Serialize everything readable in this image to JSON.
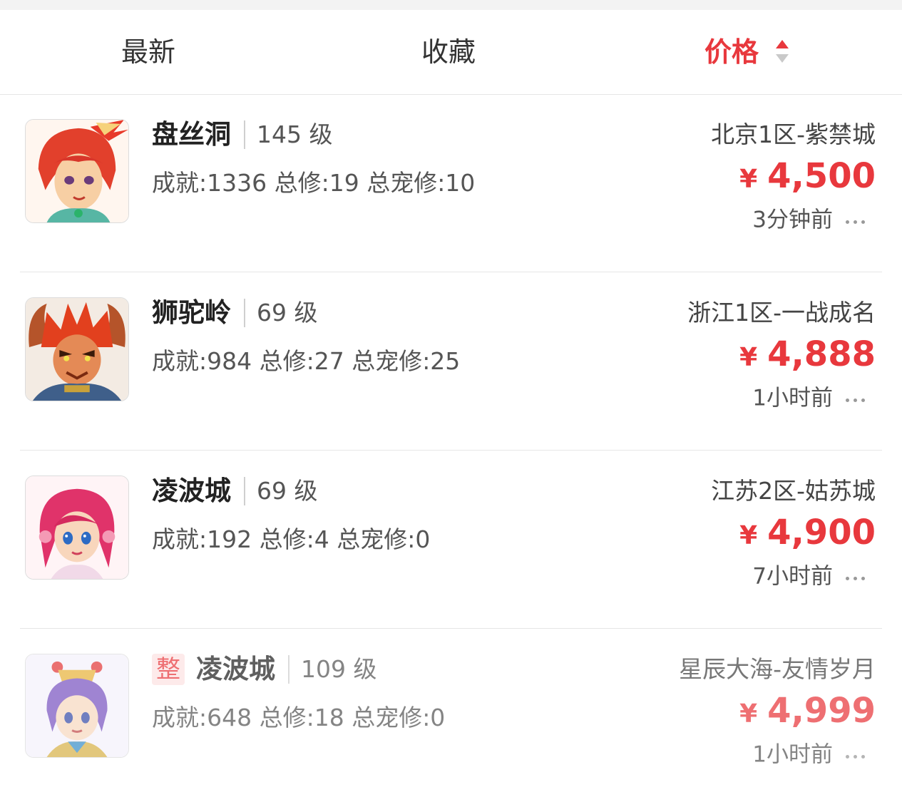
{
  "tabs": {
    "latest": "最新",
    "favorites": "收藏",
    "price": "价格"
  },
  "colors": {
    "accent": "#e8383d",
    "badge_bg": "#fde3e3"
  },
  "items": [
    {
      "badge": "",
      "name": "盘丝洞",
      "level": "145 级",
      "stats": "成就:1336 总修:19 总宠修:10",
      "server": "北京1区-紫禁城",
      "currency": "¥",
      "price": "4,500",
      "time": "3分钟前",
      "avatar_icon": "panshidong-avatar"
    },
    {
      "badge": "",
      "name": "狮驼岭",
      "level": "69 级",
      "stats": "成就:984 总修:27 总宠修:25",
      "server": "浙江1区-一战成名",
      "currency": "¥",
      "price": "4,888",
      "time": "1小时前",
      "avatar_icon": "shituoling-avatar"
    },
    {
      "badge": "",
      "name": "凌波城",
      "level": "69 级",
      "stats": "成就:192 总修:4 总宠修:0",
      "server": "江苏2区-姑苏城",
      "currency": "¥",
      "price": "4,900",
      "time": "7小时前",
      "avatar_icon": "lingbocheng-avatar"
    },
    {
      "badge": "整",
      "name": "凌波城",
      "level": "109 级",
      "stats": "成就:648 总修:18 总宠修:0",
      "server": "星辰大海-友情岁月",
      "currency": "¥",
      "price": "4,999",
      "time": "1小时前",
      "avatar_icon": "lingbocheng-avatar-2"
    }
  ]
}
